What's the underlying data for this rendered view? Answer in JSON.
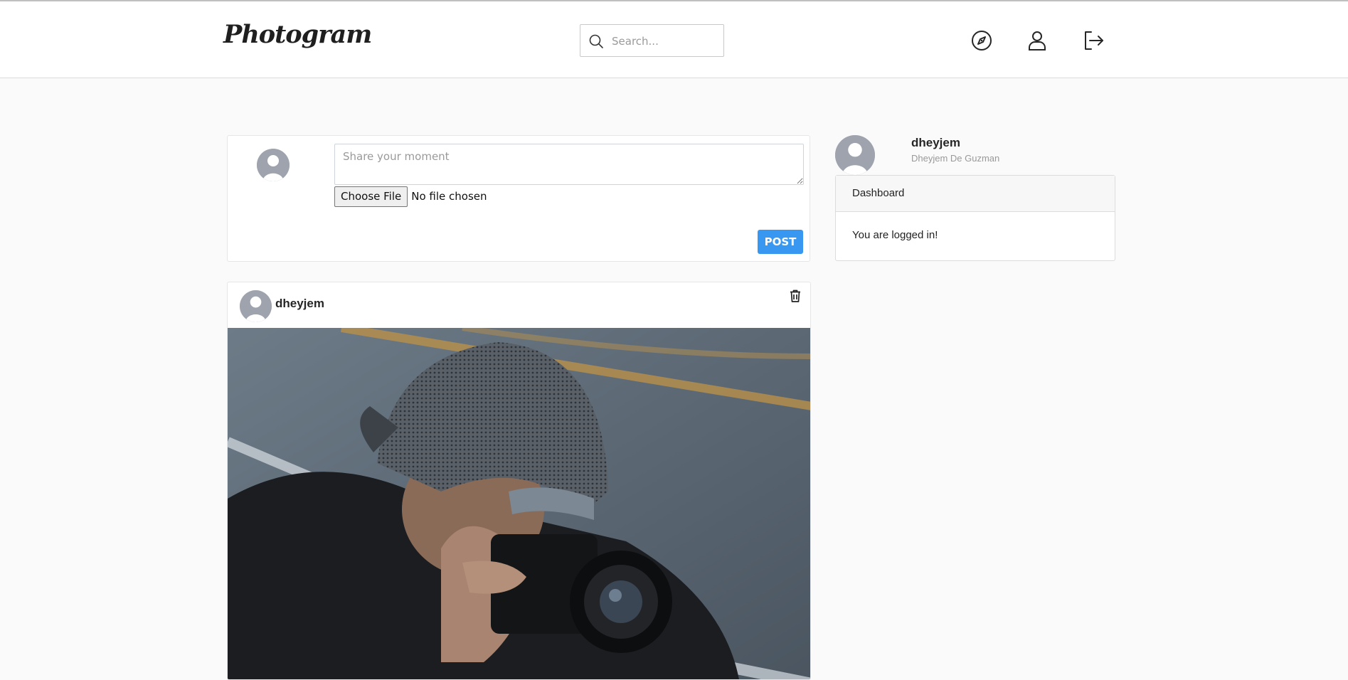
{
  "header": {
    "brand": "Photogram",
    "search": {
      "placeholder": "Search..."
    },
    "icons": [
      "compass-icon",
      "user-icon",
      "logout-icon"
    ]
  },
  "composer": {
    "placeholder": "Share your moment",
    "file_button": "Choose File",
    "file_status": "No file chosen",
    "post_button": "POST"
  },
  "post": {
    "username": "dheyjem"
  },
  "sidebar": {
    "username": "dheyjem",
    "full_name": "Dheyjem De Guzman",
    "card": {
      "title": "Dashboard",
      "message": "You are logged in!"
    }
  },
  "colors": {
    "accent": "#3897f0",
    "background": "#fafafa",
    "card_border": "#e6e6e6"
  }
}
